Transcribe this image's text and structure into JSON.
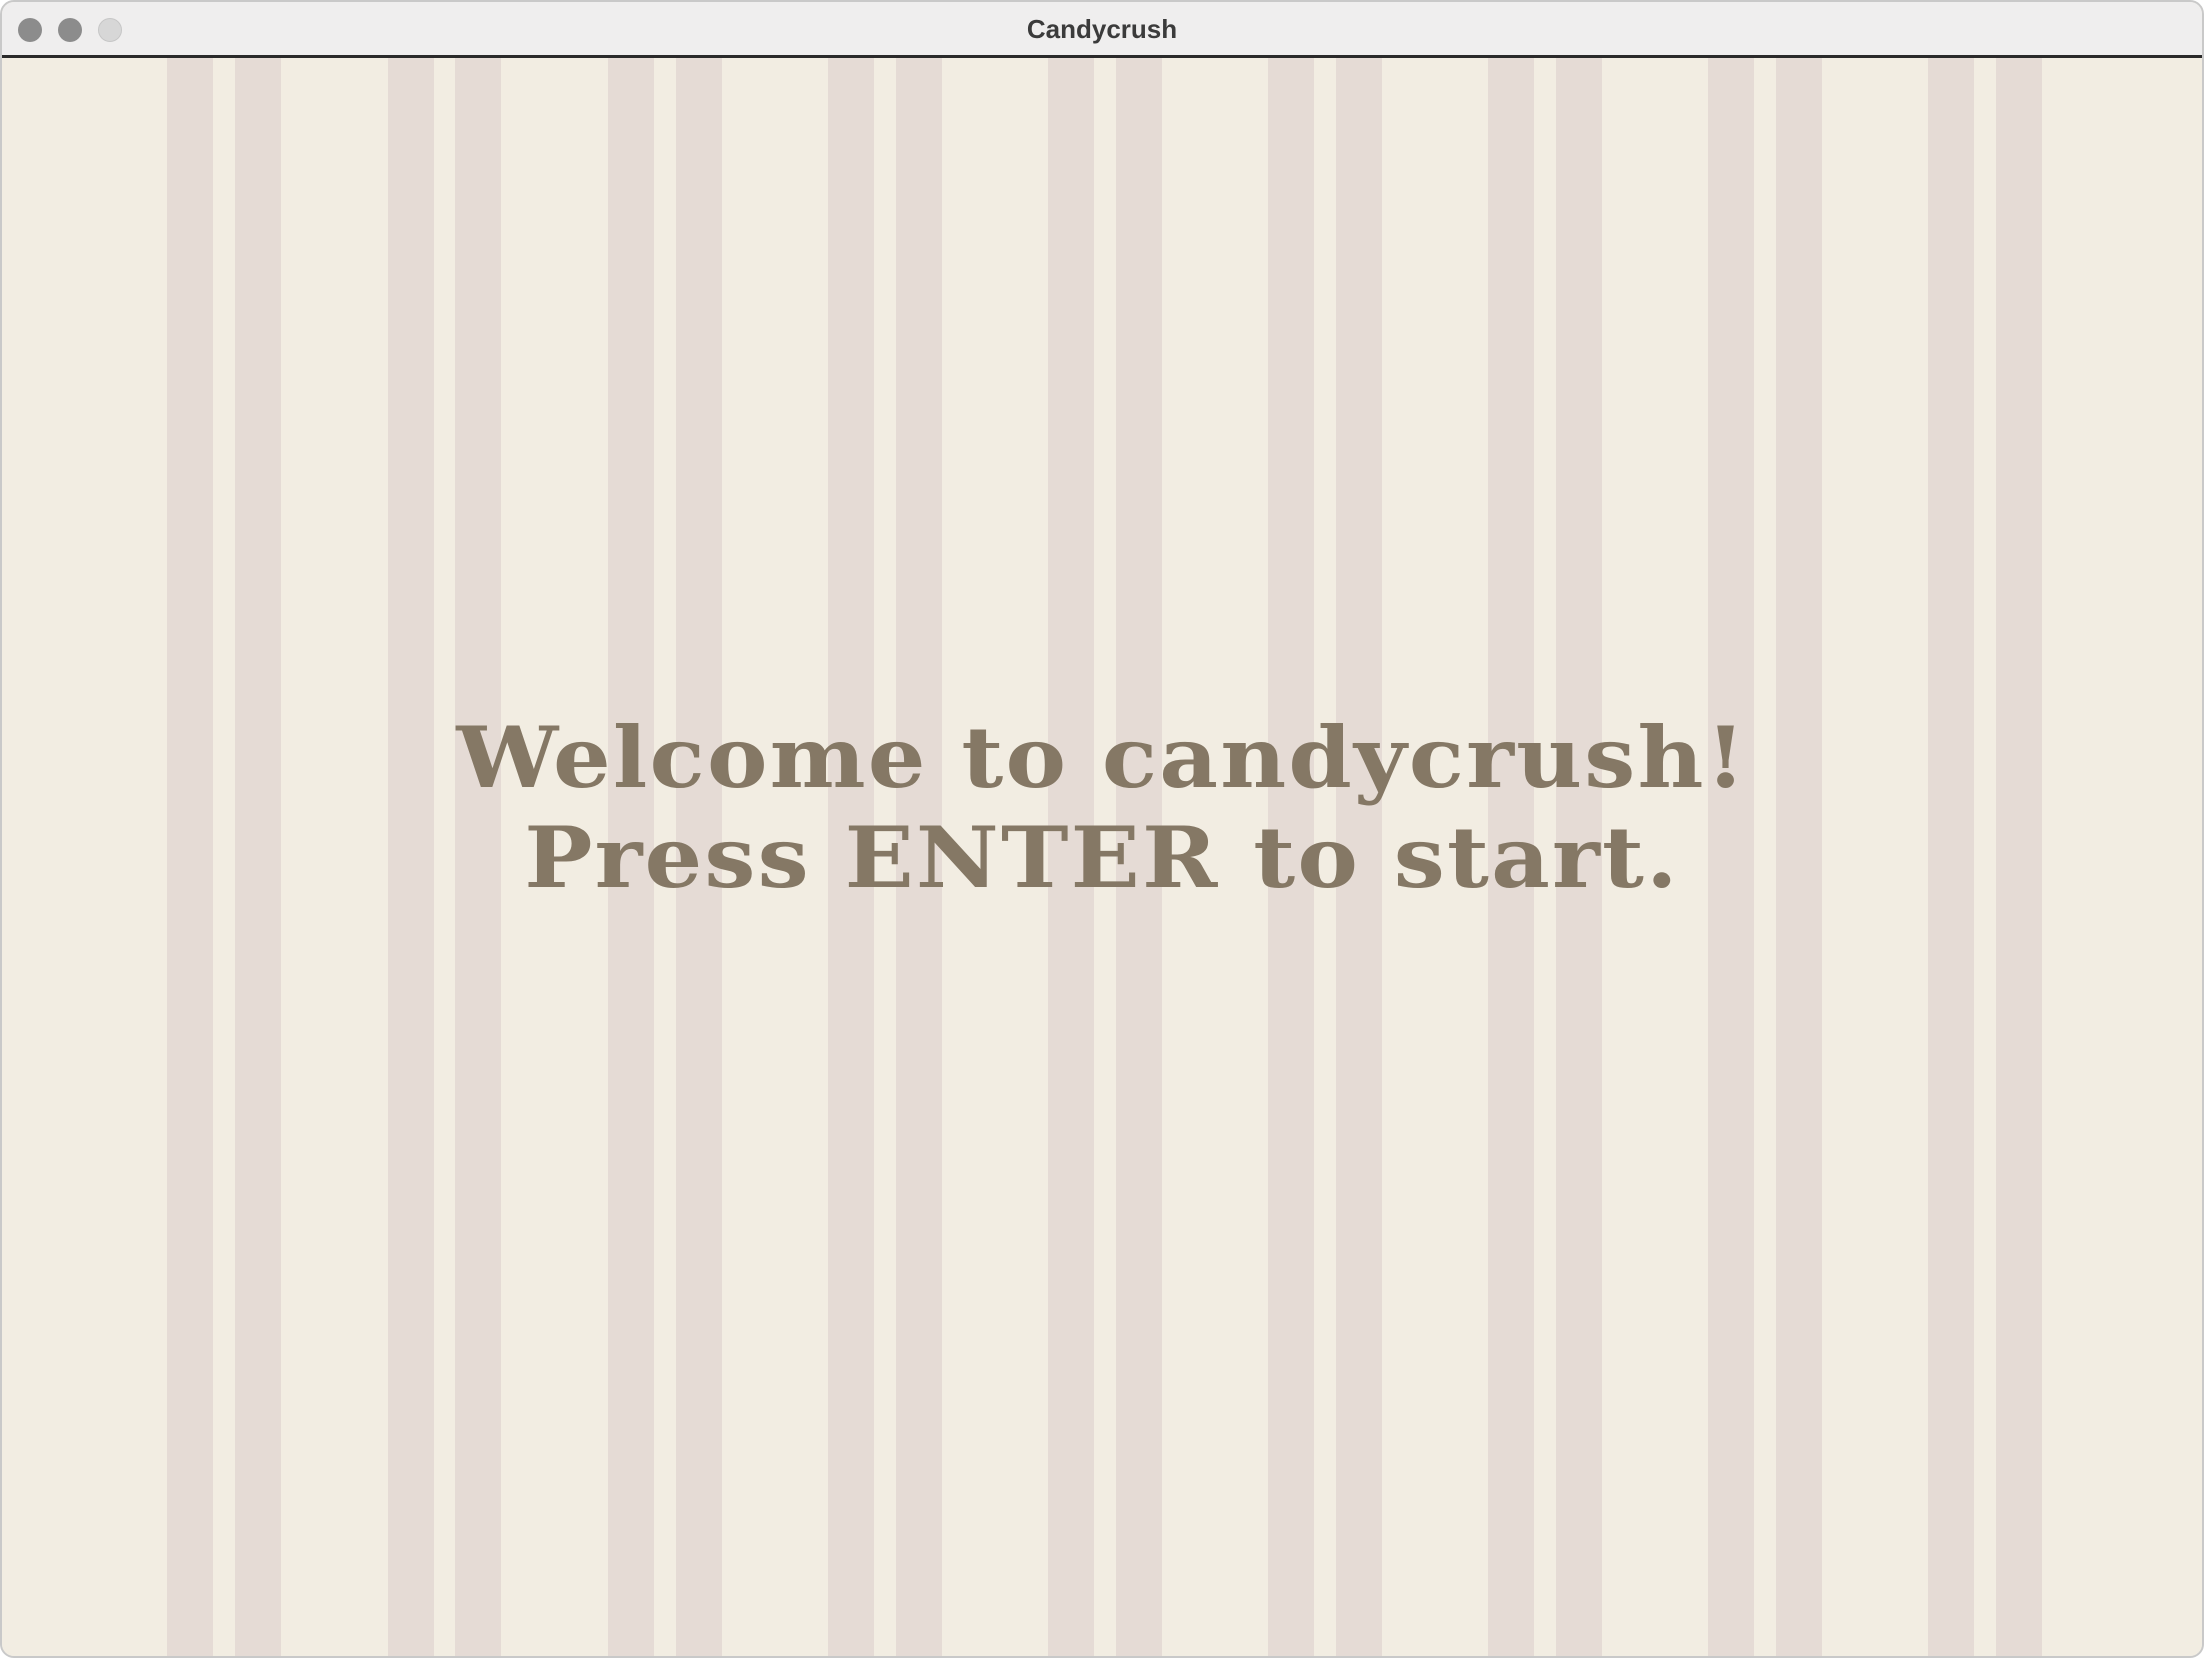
{
  "window": {
    "title": "Candycrush"
  },
  "colors": {
    "background": "#f2ede2",
    "stripe": "#e5dbd5",
    "text": "#857865"
  },
  "game": {
    "welcome_line1": "Welcome to candycrush!",
    "welcome_line2": "Press ENTER to start."
  },
  "controls": {
    "close_icon": "close-icon",
    "minimize_icon": "minimize-icon",
    "zoom_icon": "zoom-icon"
  }
}
